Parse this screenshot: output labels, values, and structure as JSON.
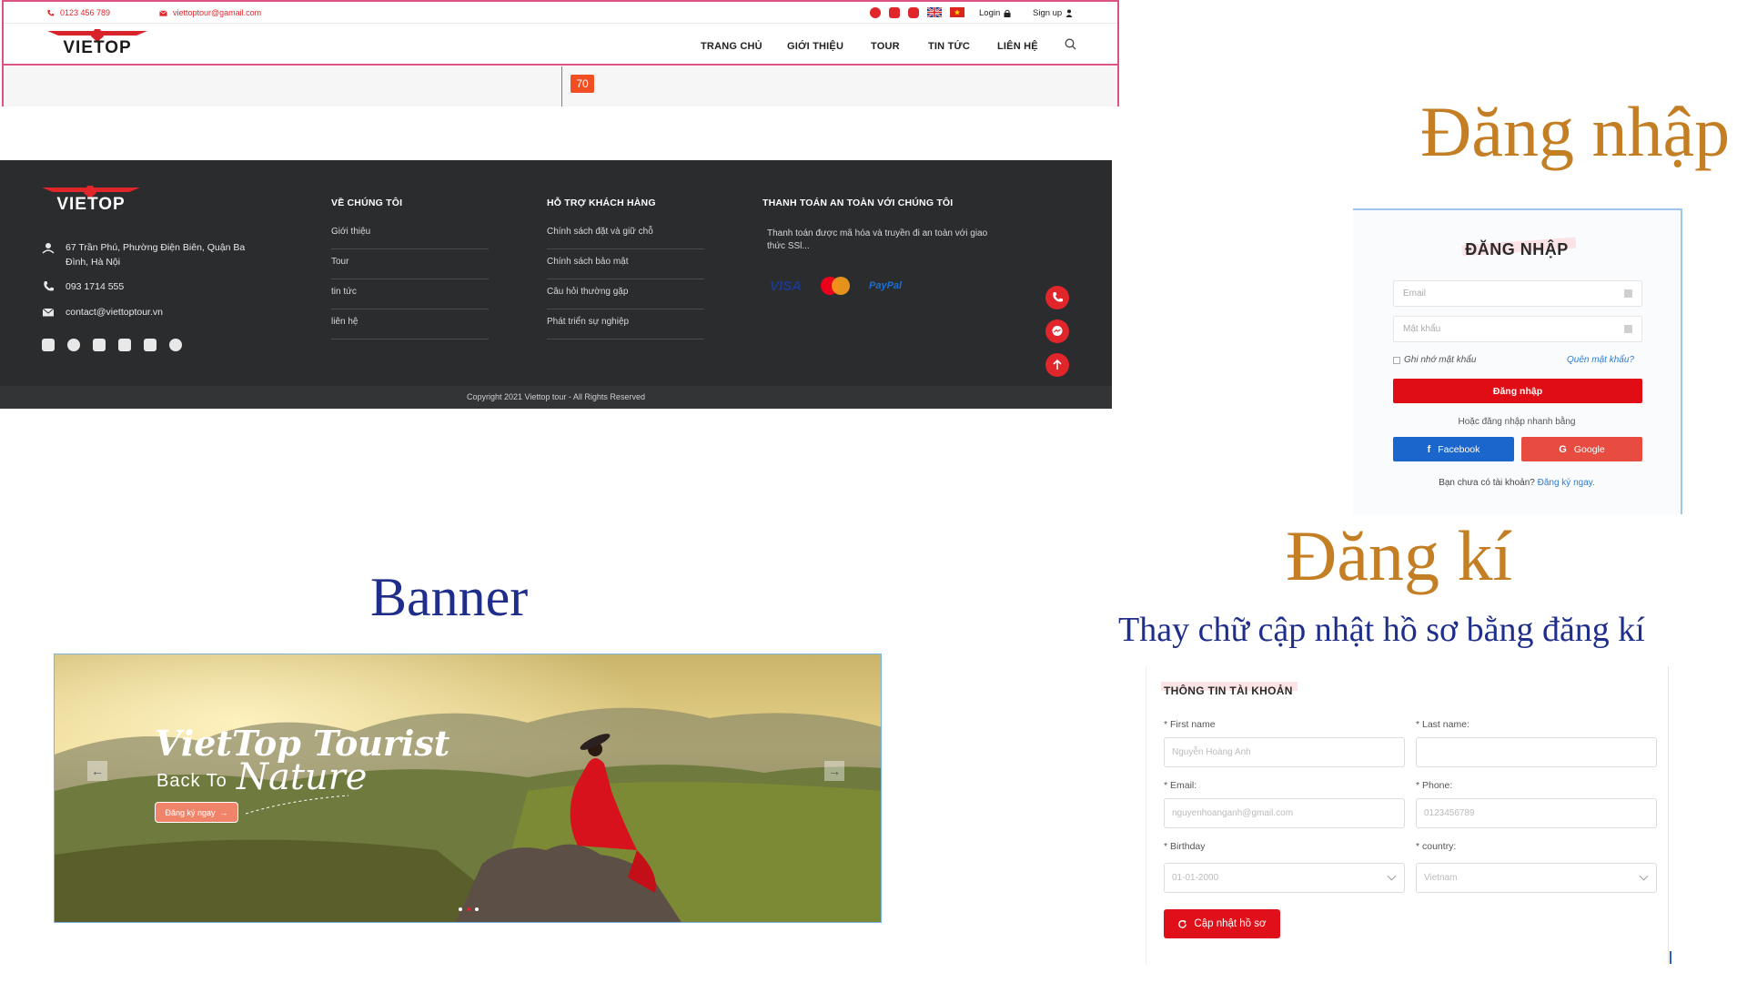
{
  "header": {
    "phone": "0123 456 789",
    "email": "viettoptour@gamail.com",
    "login_label": "Login",
    "signup_label": "Sign up",
    "logo_text": "VIETOP",
    "nav": [
      "TRANG CHỦ",
      "GIỚI THIỆU",
      "TOUR",
      "TIN TỨC",
      "LIÊN HỆ"
    ],
    "badge": "70"
  },
  "footer": {
    "logo_text": "VIETOP",
    "address": "67 Trần Phú, Phường Điện Biên, Quận Ba Đình, Hà Nội",
    "phone": "093 1714 555",
    "email": "contact@viettoptour.vn",
    "col1": {
      "title": "VỀ CHÚNG TÔI",
      "links": [
        "Giới thiệu",
        "Tour",
        "tin tức",
        "liên hệ"
      ]
    },
    "col2": {
      "title": "HỖ TRỢ KHÁCH HÀNG",
      "links": [
        "Chính sách đặt và giữ chỗ",
        "Chính sách bảo mật",
        "Câu hỏi thường gặp",
        "Phát triển sự nghiệp"
      ]
    },
    "col3": {
      "title": "THANH TOÁN AN TOÀN VỚI CHÚNG TÔI",
      "text": "Thanh toán được mã hóa và truyền đi an toàn với giao thức SSl...",
      "payments": [
        "VISA",
        "PayPal"
      ]
    },
    "copyright": "Copyright 2021 Viettop tour - All Rights Reserved"
  },
  "titles": {
    "login": "Đăng nhập",
    "register": "Đăng kí",
    "register_note": "Thay chữ cập nhật hồ sơ bằng đăng kí",
    "banner": "Banner"
  },
  "login": {
    "heading": "ĐĂNG NHẬP",
    "email_placeholder": "Email",
    "password_placeholder": "Mật khẩu",
    "remember": "Ghi nhớ mật khẩu",
    "forgot": "Quên mật khẩu?",
    "submit": "Đăng nhập",
    "or_text": "Hoặc đăng nhập nhanh bằng",
    "facebook": "Facebook",
    "google": "Google",
    "no_account": "Bạn chưa có tài khoản?",
    "register_link": "Đăng ký ngay."
  },
  "register": {
    "heading": "THÔNG TIN TÀI KHOẢN",
    "first_name_label": "* First name",
    "first_name_value": "Nguyễn Hoàng Anh",
    "last_name_label": "* Last name:",
    "last_name_value": "",
    "email_label": "* Email:",
    "email_value": "nguyenhoanganh@gmail.com",
    "phone_label": "* Phone:",
    "phone_value": "0123456789",
    "birthday_label": "* Birthday",
    "birthday_value": "01-01-2000",
    "country_label": "* country:",
    "country_value": "Vietnam",
    "submit": "Cập nhật hồ sơ"
  },
  "banner": {
    "brand_line1": "VietTop Tourist",
    "brand_line2": "Back To",
    "brand_line3": "Nature",
    "cta": "Đăng ký ngay"
  },
  "colors": {
    "brand_red": "#e0252b",
    "footer_bg": "#2b2c2e",
    "title_gold": "#c47f25",
    "title_blue": "#1f2e8a",
    "facebook": "#1877f2",
    "google": "#ea4335"
  }
}
